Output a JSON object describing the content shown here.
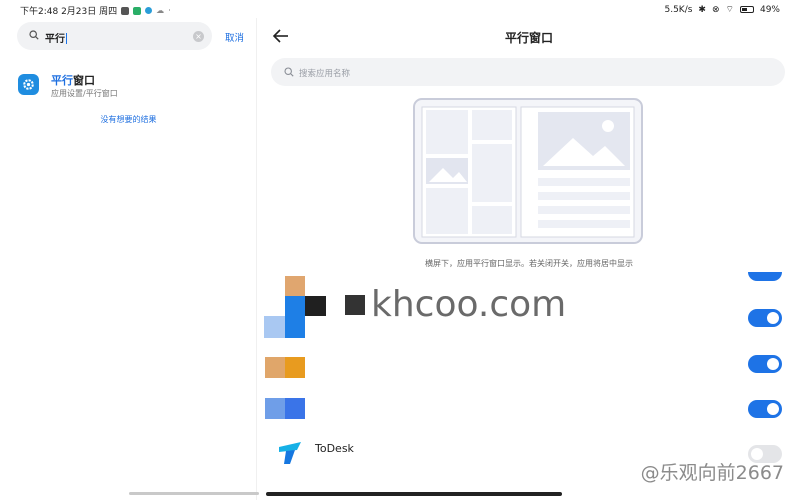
{
  "status_bar": {
    "time_date": "下午2:48 2月23日 周四",
    "network_speed": "5.5K/s",
    "battery": "49%"
  },
  "left_pane": {
    "search": {
      "value": "平行"
    },
    "cancel_label": "取消",
    "result": {
      "title_highlight": "平行",
      "title_rest": "窗口",
      "subtitle": "应用设置/平行窗口"
    },
    "no_result_link": "没有想要的结果"
  },
  "right_pane": {
    "title": "平行窗口",
    "search_placeholder": "搜索应用名称",
    "caption": "横屏下，应用平行窗口显示。若关闭开关，应用将居中显示",
    "apps": [
      {
        "name": "",
        "toggle_on": true
      },
      {
        "name": "",
        "toggle_on": true
      },
      {
        "name": "",
        "toggle_on": true
      },
      {
        "name": "",
        "toggle_on": true
      },
      {
        "name": "ToDesk",
        "toggle_on": false
      }
    ]
  },
  "watermark": {
    "text": "khcoo.com"
  },
  "credit": {
    "text": "@乐观向前2667"
  },
  "colors": {
    "accent": "#1e73e6",
    "icon_blue": "#1f8de0"
  }
}
